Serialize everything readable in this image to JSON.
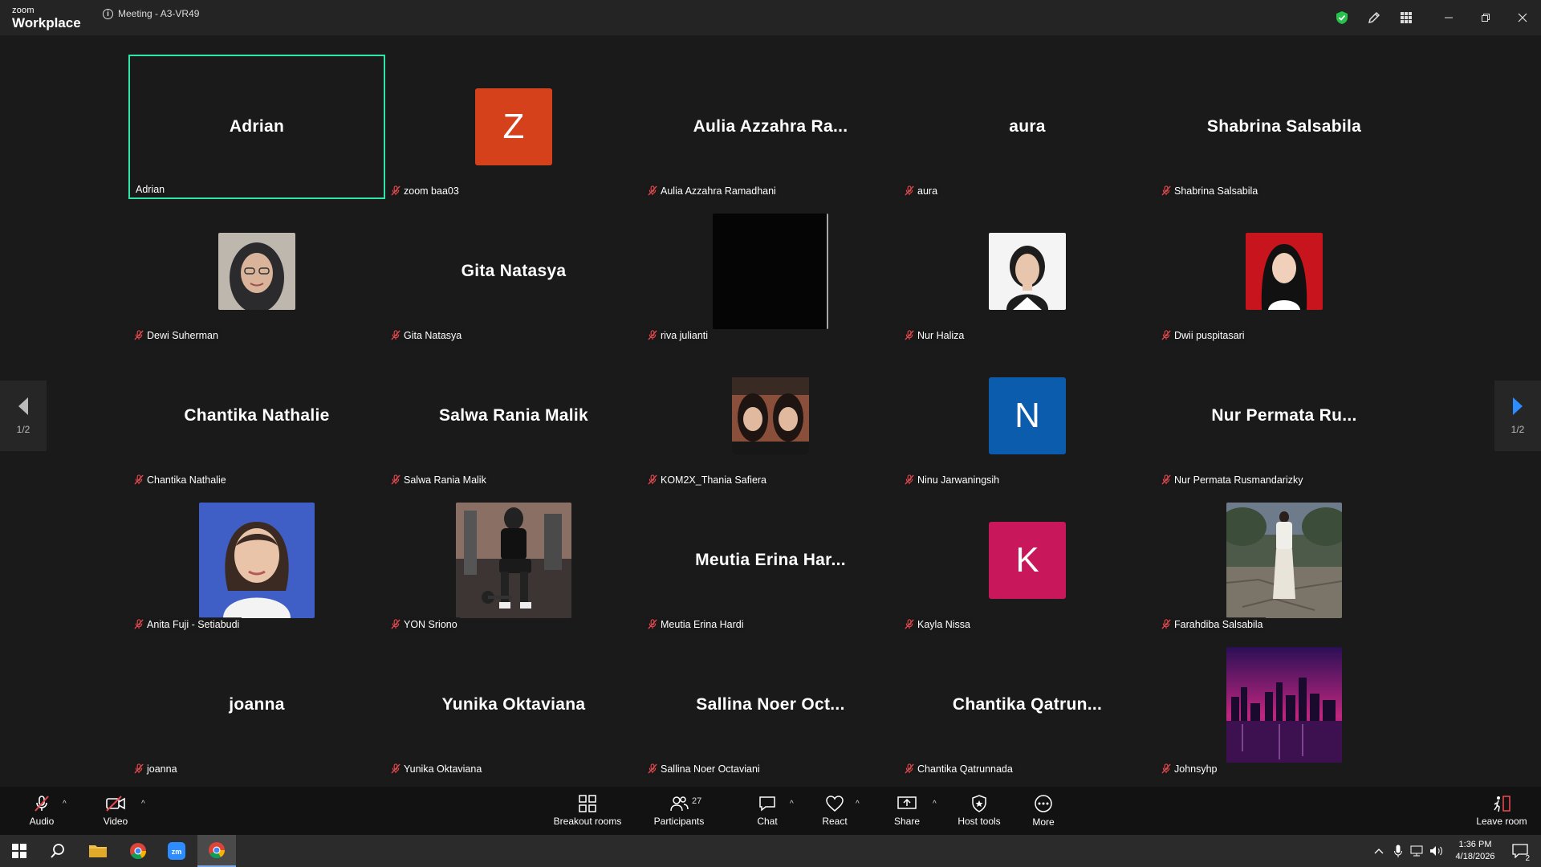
{
  "app": {
    "brand_small": "zoom",
    "brand_big": "Workplace",
    "meeting_title": "Meeting - A3-VR49"
  },
  "colors": {
    "active_border": "#2ee6a6",
    "mic_off": "#e5484d",
    "security_green": "#27c24c",
    "nav_arrow": "#2d8cff",
    "avatar_z": "#d5411b",
    "avatar_n": "#0b5cad",
    "avatar_k": "#c8175a"
  },
  "tiles": [
    {
      "display": "Adrian",
      "label": "Adrian",
      "type": "name",
      "active": true,
      "muted": false
    },
    {
      "display": "Z",
      "label": "zoom baa03",
      "type": "letter",
      "color": "#d5411b",
      "muted": true
    },
    {
      "display": "Aulia Azzahra Ra...",
      "label": "Aulia Azzahra Ramadhani",
      "type": "name",
      "muted": true
    },
    {
      "display": "aura",
      "label": "aura",
      "type": "name",
      "muted": true
    },
    {
      "display": "Shabrina Salsabila",
      "label": "Shabrina Salsabila",
      "type": "name",
      "muted": true
    },
    {
      "display": "",
      "label": "Dewi Suherman",
      "type": "photo",
      "photo": "hijab",
      "muted": true
    },
    {
      "display": "Gita Natasya",
      "label": "Gita Natasya",
      "type": "name",
      "muted": true
    },
    {
      "display": "",
      "label": "riva julianti",
      "type": "photo",
      "photo": "black",
      "muted": true
    },
    {
      "display": "",
      "label": "Nur Haliza",
      "type": "photo",
      "photo": "portrait-white",
      "muted": true
    },
    {
      "display": "",
      "label": "Dwii puspitasari",
      "type": "photo",
      "photo": "portrait-red",
      "muted": true
    },
    {
      "display": "Chantika Nathalie",
      "label": "Chantika Nathalie",
      "type": "name",
      "muted": true
    },
    {
      "display": "Salwa Rania Malik",
      "label": "Salwa Rania Malik",
      "type": "name",
      "muted": true
    },
    {
      "display": "",
      "label": "KOM2X_Thania Safiera",
      "type": "photo",
      "photo": "two-faces",
      "muted": true
    },
    {
      "display": "N",
      "label": "Ninu Jarwaningsih",
      "type": "letter",
      "color": "#0b5cad",
      "muted": true
    },
    {
      "display": "Nur Permata Ru...",
      "label": "Nur Permata Rusmandarizky",
      "type": "name",
      "muted": true
    },
    {
      "display": "",
      "label": "Anita Fuji - Setiabudi",
      "type": "photo",
      "photo": "portrait-blue",
      "muted": true
    },
    {
      "display": "",
      "label": "YON Sriono",
      "type": "photo",
      "photo": "gym",
      "muted": true
    },
    {
      "display": "Meutia Erina Har...",
      "label": "Meutia Erina Hardi",
      "type": "name",
      "muted": true
    },
    {
      "display": "K",
      "label": "Kayla Nissa",
      "type": "letter",
      "color": "#c8175a",
      "muted": true
    },
    {
      "display": "",
      "label": "Farahdiba Salsabila",
      "type": "photo",
      "photo": "outdoor",
      "muted": true
    },
    {
      "display": "joanna",
      "label": "joanna",
      "type": "name",
      "muted": true
    },
    {
      "display": "Yunika Oktaviana",
      "label": "Yunika Oktaviana",
      "type": "name",
      "muted": true
    },
    {
      "display": "Sallina Noer Oct...",
      "label": "Sallina Noer Octaviani",
      "type": "name",
      "muted": true
    },
    {
      "display": "Chantika Qatrun...",
      "label": "Chantika Qatrunnada",
      "type": "name",
      "muted": true
    },
    {
      "display": "",
      "label": "Johnsyhp",
      "type": "photo",
      "photo": "city",
      "muted": true
    }
  ],
  "pagination": {
    "left": "1/2",
    "right": "1/2"
  },
  "toolbar": {
    "audio": "Audio",
    "video": "Video",
    "breakout": "Breakout rooms",
    "participants": "Participants",
    "participants_count": "27",
    "chat": "Chat",
    "react": "React",
    "share": "Share",
    "host_tools": "Host tools",
    "more": "More",
    "leave": "Leave room"
  },
  "taskbar": {
    "time": "1:36 PM",
    "date": "4/18/2026",
    "notifications": "2"
  }
}
